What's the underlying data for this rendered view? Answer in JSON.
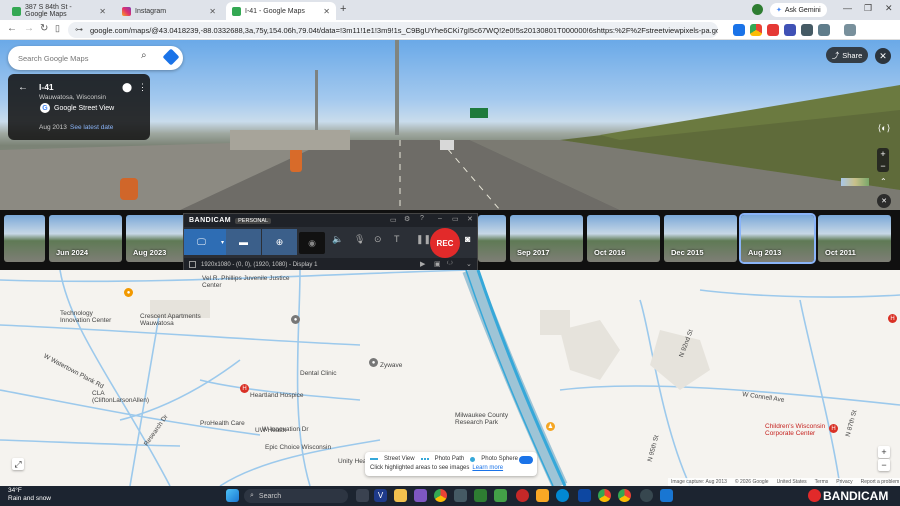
{
  "browser": {
    "tabs": [
      {
        "title": "387 S 84th St - Google Maps",
        "active": false
      },
      {
        "title": "Instagram",
        "active": false
      },
      {
        "title": "I-41 - Google Maps",
        "active": true
      }
    ],
    "ask_gemini": "Ask Gemini",
    "url": "google.com/maps/@43.0418239,-88.0332688,3a,75y,154.06h,79.04t/data=!3m11!1e1!3m9!1s_C9BgUYhe6CKi7gI5c67WQ!2e0!5s20130801T000000!6shttps:%2F%2Fstreetviewpixels-pa.googleapis.com%2Fv1...",
    "profile_initial": "E"
  },
  "street_view": {
    "search_placeholder": "Search Google Maps",
    "road_name": "I-41",
    "location": "Wauwatosa, Wisconsin",
    "source": "Google Street View",
    "capture_date": "Aug 2013",
    "latest_link": "See latest date",
    "share_label": "Share"
  },
  "timeline": [
    {
      "label": "",
      "selected": false
    },
    {
      "label": "Jun 2024",
      "selected": false
    },
    {
      "label": "Aug 2023",
      "selected": false
    },
    {
      "label": "Sep 2017",
      "selected": false
    },
    {
      "label": "Oct 2016",
      "selected": false
    },
    {
      "label": "Dec 2015",
      "selected": false
    },
    {
      "label": "Aug 2013",
      "selected": true
    },
    {
      "label": "Oct 2011",
      "selected": false
    }
  ],
  "bandicam": {
    "brand": "BANDICAM",
    "edition": "PERSONAL",
    "rec_label": "REC",
    "status": "1920x1080 - (0, 0), (1920, 1080) - Display 1"
  },
  "map": {
    "labels": [
      {
        "text": "Vel R. Phillips Juvenile Justice Center",
        "kind": "place"
      },
      {
        "text": "Technology Innovation Center",
        "kind": "place"
      },
      {
        "text": "Crescent Apartments Wauwatosa",
        "kind": "place"
      },
      {
        "text": "Zywave",
        "kind": "place"
      },
      {
        "text": "Heartland Hospice",
        "kind": "place"
      },
      {
        "text": "Milwaukee County Research Park",
        "kind": "place"
      },
      {
        "text": "ProHealth Care",
        "kind": "place"
      },
      {
        "text": "Dental Clinic",
        "kind": "place"
      },
      {
        "text": "CLA (CliftonLarsonAllen)",
        "kind": "place"
      },
      {
        "text": "Children's Wisconsin Corporate Center",
        "kind": "hospital"
      },
      {
        "text": "UW Health",
        "kind": "place"
      },
      {
        "text": "Epic Choice Wisconsin",
        "kind": "place"
      },
      {
        "text": "Unity Health",
        "kind": "place"
      },
      {
        "text": "W Watertown Plank Rd",
        "kind": "road"
      },
      {
        "text": "W Innovation Dr",
        "kind": "road"
      },
      {
        "text": "Research Dr",
        "kind": "road"
      },
      {
        "text": "N 92nd St",
        "kind": "road"
      },
      {
        "text": "N 95th St",
        "kind": "road"
      },
      {
        "text": "N 87th St",
        "kind": "road"
      },
      {
        "text": "W Connell Ave",
        "kind": "road"
      }
    ],
    "legend": {
      "street_view": "Street View",
      "photo_path": "Photo Path",
      "photo_sphere": "Photo Sphere",
      "hint": "Click highlighted areas to see images",
      "learn_more": "Learn more"
    },
    "attribution": [
      "Image capture: Aug 2013",
      "© 2026 Google",
      "United States",
      "Terms",
      "Privacy",
      "Report a problem"
    ]
  },
  "taskbar": {
    "weather_temp": "34°F",
    "weather_desc": "Rain and snow",
    "search_label": "Search",
    "watermark": "BANDICAM"
  }
}
